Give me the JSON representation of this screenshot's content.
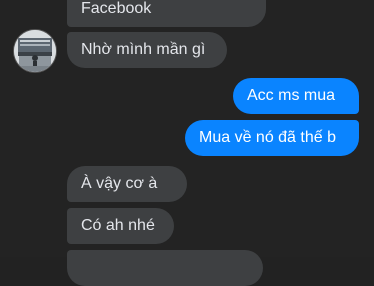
{
  "messages": [
    {
      "id": "m1",
      "side": "in",
      "text": "Facebook"
    },
    {
      "id": "m2",
      "side": "in",
      "text": "Nhờ mình mần gì"
    },
    {
      "id": "m3",
      "side": "out",
      "text": "Acc ms mua"
    },
    {
      "id": "m4",
      "side": "out",
      "text": "Mua về nó đã thế b"
    },
    {
      "id": "m5",
      "side": "in",
      "text": "À vậy cơ à"
    },
    {
      "id": "m6",
      "side": "in",
      "text": "Có ah nhé"
    },
    {
      "id": "m7",
      "side": "in",
      "text": ""
    }
  ],
  "colors": {
    "background": "#232323",
    "incoming_bubble": "#3e4042",
    "outgoing_bubble": "#0a84ff"
  },
  "avatar": {
    "icon": "contact-avatar-photo"
  }
}
